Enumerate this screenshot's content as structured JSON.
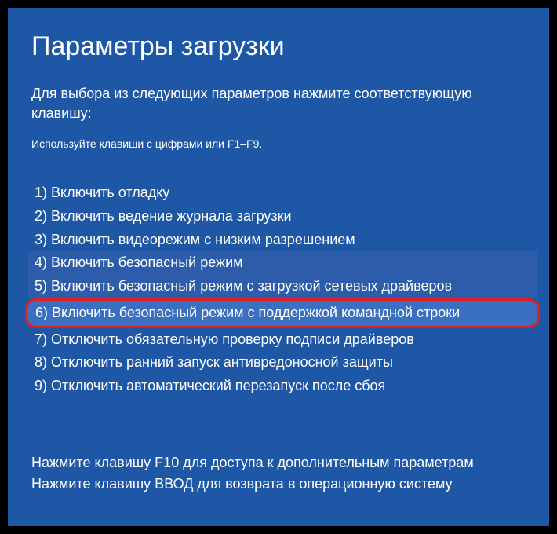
{
  "title": "Параметры загрузки",
  "subtitle": "Для выбора из следующих параметров нажмите соответствующую клавишу:",
  "hint": "Используйте клавиши с цифрами или F1–F9.",
  "options": [
    {
      "num": "1",
      "label": "Включить отладку",
      "state": "normal"
    },
    {
      "num": "2",
      "label": "Включить ведение журнала загрузки",
      "state": "normal"
    },
    {
      "num": "3",
      "label": "Включить видеорежим с низким разрешением",
      "state": "normal"
    },
    {
      "num": "4",
      "label": "Включить безопасный режим",
      "state": "selected"
    },
    {
      "num": "5",
      "label": "Включить безопасный режим с загрузкой сетевых драйверов",
      "state": "selected"
    },
    {
      "num": "6",
      "label": "Включить безопасный режим с поддержкой командной строки",
      "state": "highlighted"
    },
    {
      "num": "7",
      "label": "Отключить обязательную проверку подписи драйверов",
      "state": "normal"
    },
    {
      "num": "8",
      "label": "Отключить ранний запуск антивредоносной защиты",
      "state": "normal"
    },
    {
      "num": "9",
      "label": "Отключить автоматический перезапуск после сбоя",
      "state": "normal"
    }
  ],
  "footer": {
    "line1": "Нажмите клавишу F10 для доступа к дополнительным параметрам",
    "line2": "Нажмите клавишу ВВОД для возврата в операционную систему"
  }
}
